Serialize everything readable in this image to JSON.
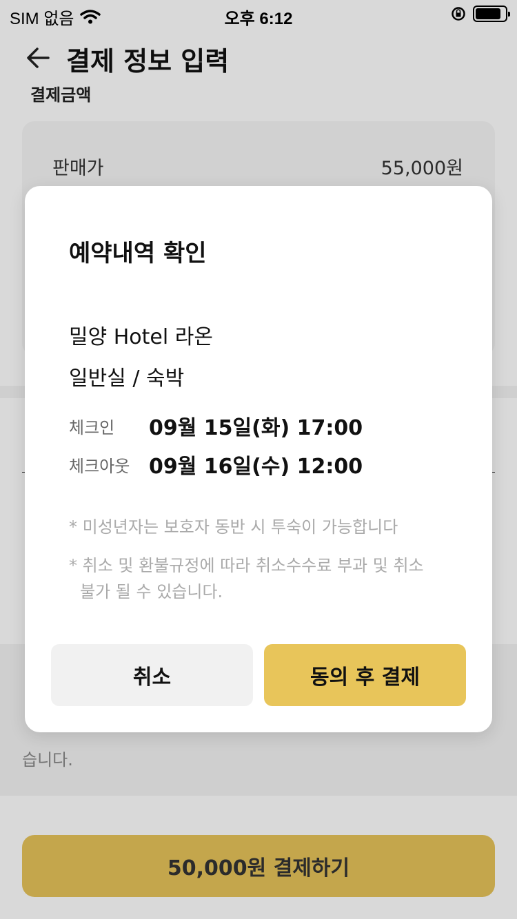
{
  "status_bar": {
    "carrier": "SIM 없음",
    "time": "오후 6:12"
  },
  "header": {
    "title": "결제 정보 입력",
    "section_label": "결제금액"
  },
  "price": {
    "label": "판매가",
    "value": "55,000원"
  },
  "notice_text_partial": "습니다.",
  "pay_button": {
    "label": "50,000원 결제하기"
  },
  "modal": {
    "title": "예약내역 확인",
    "hotel_name": "밀양 Hotel 라온",
    "room_type": "일반실 / 숙박",
    "checkin": {
      "label": "체크인",
      "value": "09월 15일(화) 17:00"
    },
    "checkout": {
      "label": "체크아웃",
      "value": "09월 16일(수) 12:00"
    },
    "note_1": "* 미성년자는 보호자 동반 시 투숙이 가능합니다",
    "note_2_line1": "* 취소 및 환불규정에 따라 취소수수료 부과 및 취소",
    "note_2_line2": "불가 될 수 있습니다.",
    "cancel_label": "취소",
    "agree_label": "동의 후 결제"
  },
  "colors": {
    "accent": "#e7c45a",
    "cancel_bg": "#f1f1f1"
  }
}
